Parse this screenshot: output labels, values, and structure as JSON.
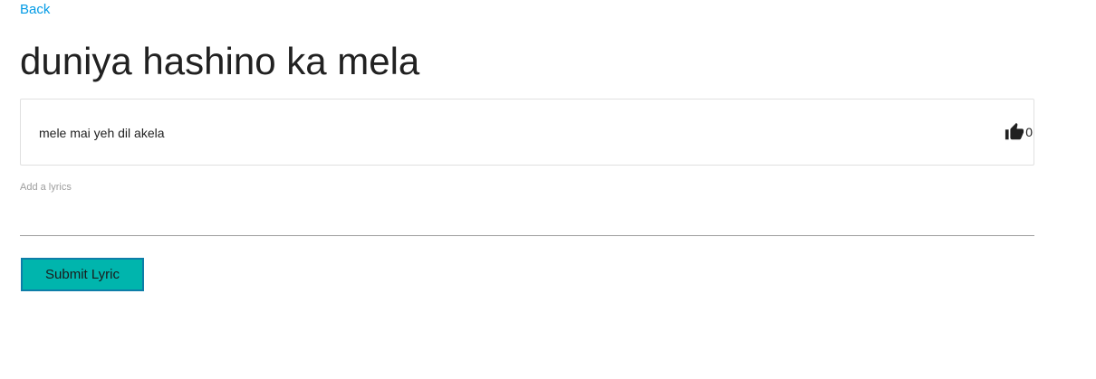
{
  "nav": {
    "back_label": "Back"
  },
  "song": {
    "title": "duniya hashino ka mela"
  },
  "lyrics": [
    {
      "content": "mele mai yeh dil akela",
      "likes": "0",
      "like_icon": "thumb-up-icon"
    }
  ],
  "form": {
    "label": "Add a lyrics",
    "input_value": "",
    "submit_label": "Submit Lyric"
  },
  "colors": {
    "link": "#039be5",
    "button_bg": "#00b5ad",
    "button_border": "#0d7ea8",
    "text": "#212121",
    "muted": "#9e9e9e"
  }
}
